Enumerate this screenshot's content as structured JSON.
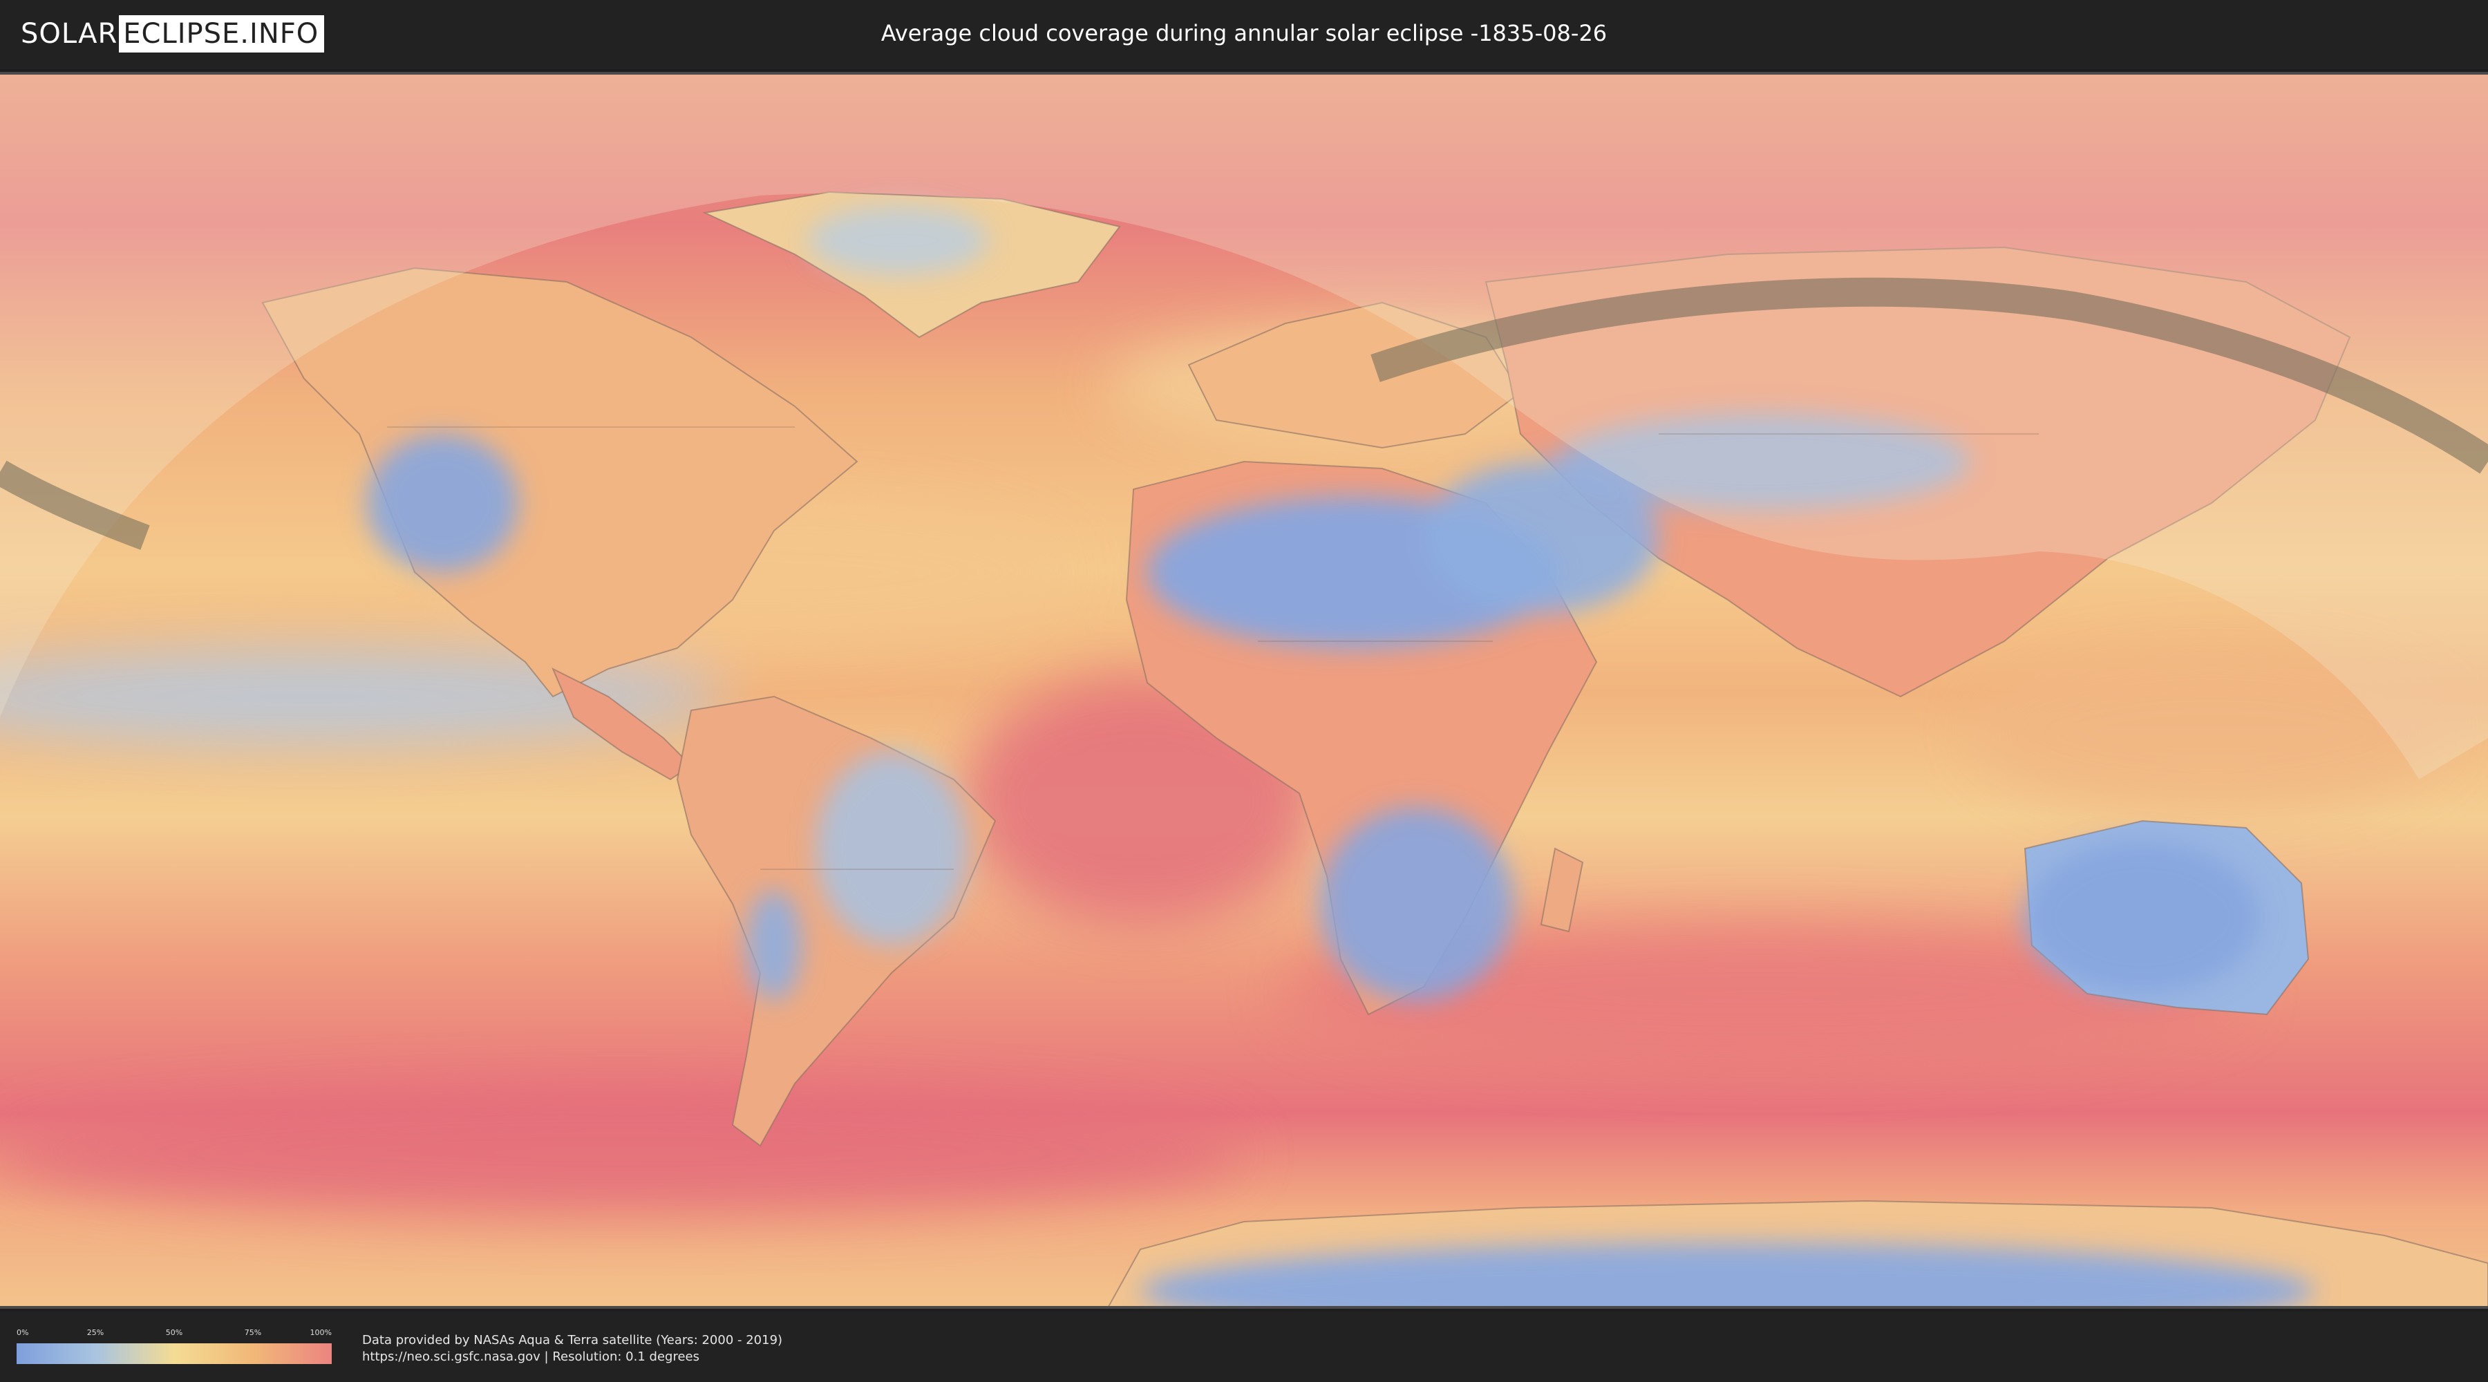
{
  "header": {
    "logo_left": "SOLAR",
    "logo_right": "ECLIPSE.INFO",
    "title": "Average cloud coverage during annular solar eclipse -1835-08-26"
  },
  "legend": {
    "ticks": [
      "0%",
      "25%",
      "50%",
      "75%",
      "100%"
    ],
    "tick_values": [
      0,
      25,
      50,
      75,
      100
    ],
    "colors": [
      "#7f9fdc",
      "#a8c4e0",
      "#f4dc94",
      "#f1b878",
      "#ec8480"
    ]
  },
  "footer": {
    "credit_line1": "Data provided by NASAs Aqua & Terra satellite (Years: 2000 - 2019)",
    "credit_line2": "https://neo.sci.gsfc.nasa.gov | Resolution: 0.1 degrees"
  },
  "map": {
    "cloud_scale": [
      "#7f9fdc",
      "#f4dc94",
      "#ec8480"
    ],
    "eclipse_path_color": "#6e6a58",
    "visibility_zone_color": "#f3eed5"
  }
}
